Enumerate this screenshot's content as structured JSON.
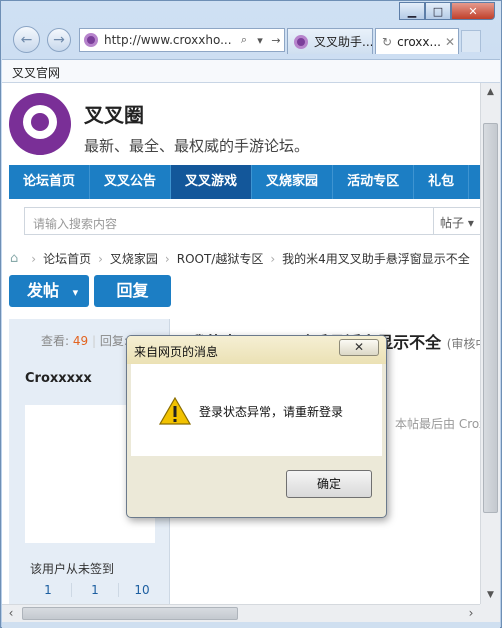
{
  "browser": {
    "address": "http://www.croxxho...",
    "tabs": [
      "叉叉助手...",
      "croxx..."
    ],
    "favorites": [
      "叉叉官网"
    ]
  },
  "site": {
    "name": "叉叉圈",
    "slogan": "最新、最全、最权威的手游论坛。",
    "nav": [
      "论坛首页",
      "叉叉公告",
      "叉叉游戏",
      "叉烧家园",
      "活动专区",
      "礼包"
    ],
    "nav_active": "叉叉游戏",
    "brand_color": "#1c7ec4",
    "logo_color": "#7a2f97"
  },
  "search": {
    "placeholder": "请输入搜索内容",
    "scope": "帖子"
  },
  "breadcrumb": [
    "论坛首页",
    "叉烧家园",
    "ROOT/越狱专区",
    "我的米4用叉叉助手悬浮窗显示不全"
  ],
  "actions": {
    "post": "发帖",
    "reply": "回复"
  },
  "thread": {
    "views_label": "查看:",
    "views": "49",
    "replies_label": "回复:",
    "title": "我的米4用叉叉助手悬浮窗显示不全",
    "review": "(审核中)",
    "last_edit": "本帖最后由 Croxxxxx"
  },
  "user": {
    "name": "Croxxxxx",
    "sign_status": "该用户从未签到",
    "counts": [
      "1",
      "1",
      "10"
    ]
  },
  "dialog": {
    "title": "来自网页的消息",
    "message": "登录状态异常，请重新登录",
    "ok": "确定",
    "icon": "warning-icon"
  }
}
